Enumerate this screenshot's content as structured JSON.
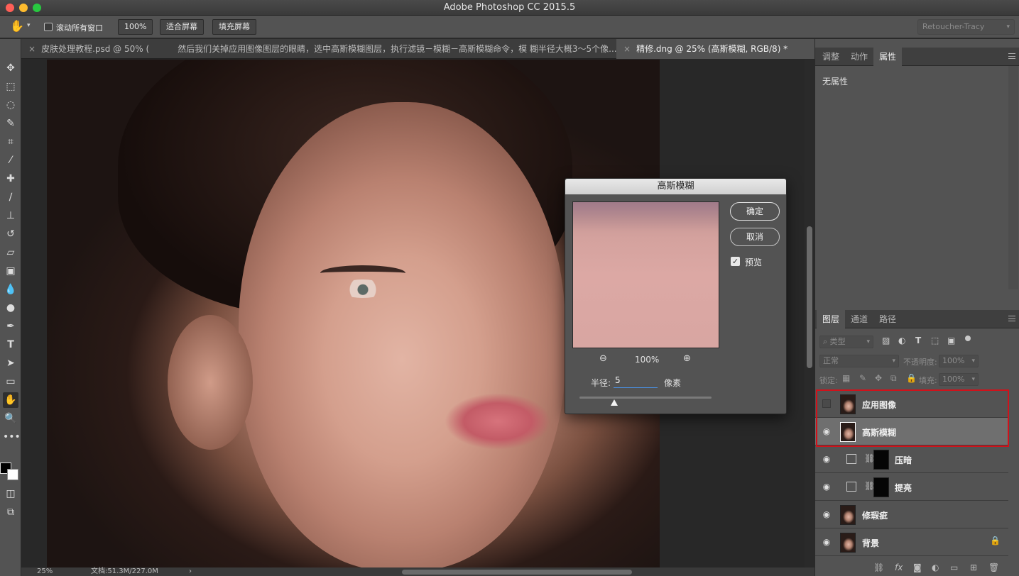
{
  "window": {
    "title": "Adobe Photoshop CC 2015.5"
  },
  "options_bar": {
    "scroll_all_label": "滚动所有窗口",
    "zoom_100": "100%",
    "fit_screen": "适合屏幕",
    "fill_screen": "填充屏幕",
    "workspace": "Retoucher-Tracy"
  },
  "tabs": [
    {
      "label": "皮肤处理教程.psd @ 50% ("
    },
    {
      "label": "然后我们关掉应用图像图层的眼睛，选中高斯模糊图层，执行滤镜－模糊－高斯模糊命令，模 糊半径大概3～5个像..."
    },
    {
      "label": "精修.dng @ 25% (高斯模糊, RGB/8) *"
    }
  ],
  "status": {
    "zoom": "25%",
    "doc": "文档:51.3M/227.0M",
    "arrow": "›"
  },
  "dialog": {
    "title": "高斯模糊",
    "ok": "确定",
    "cancel": "取消",
    "preview_label": "预览",
    "zoom_level": "100%",
    "radius_label": "半径:",
    "radius_value": "5",
    "unit": "像素"
  },
  "properties_panel": {
    "tabs": [
      "调整",
      "动作",
      "属性"
    ],
    "active_tab": "属性",
    "content": "无属性"
  },
  "layers_panel": {
    "tabs": [
      "图层",
      "通道",
      "路径"
    ],
    "active_tab": "图层",
    "filter_kind": "类型",
    "blend_mode": "正常",
    "opacity_label": "不透明度:",
    "opacity_value": "100%",
    "lock_label": "锁定:",
    "fill_label": "填充:",
    "fill_value": "100%",
    "layers": [
      {
        "name": "应用图像",
        "visible": false,
        "selected": false,
        "type": "pixel"
      },
      {
        "name": "高斯模糊",
        "visible": true,
        "selected": true,
        "type": "pixel"
      },
      {
        "name": "压暗",
        "visible": true,
        "selected": false,
        "type": "curves"
      },
      {
        "name": "提亮",
        "visible": true,
        "selected": false,
        "type": "curves"
      },
      {
        "name": "修瑕疵",
        "visible": true,
        "selected": false,
        "type": "pixel"
      },
      {
        "name": "背景",
        "visible": true,
        "selected": false,
        "type": "pixel",
        "locked": true
      }
    ],
    "highlight_color": "#d0121b"
  },
  "colors": {
    "foreground": "#000000",
    "background": "#ffffff"
  }
}
